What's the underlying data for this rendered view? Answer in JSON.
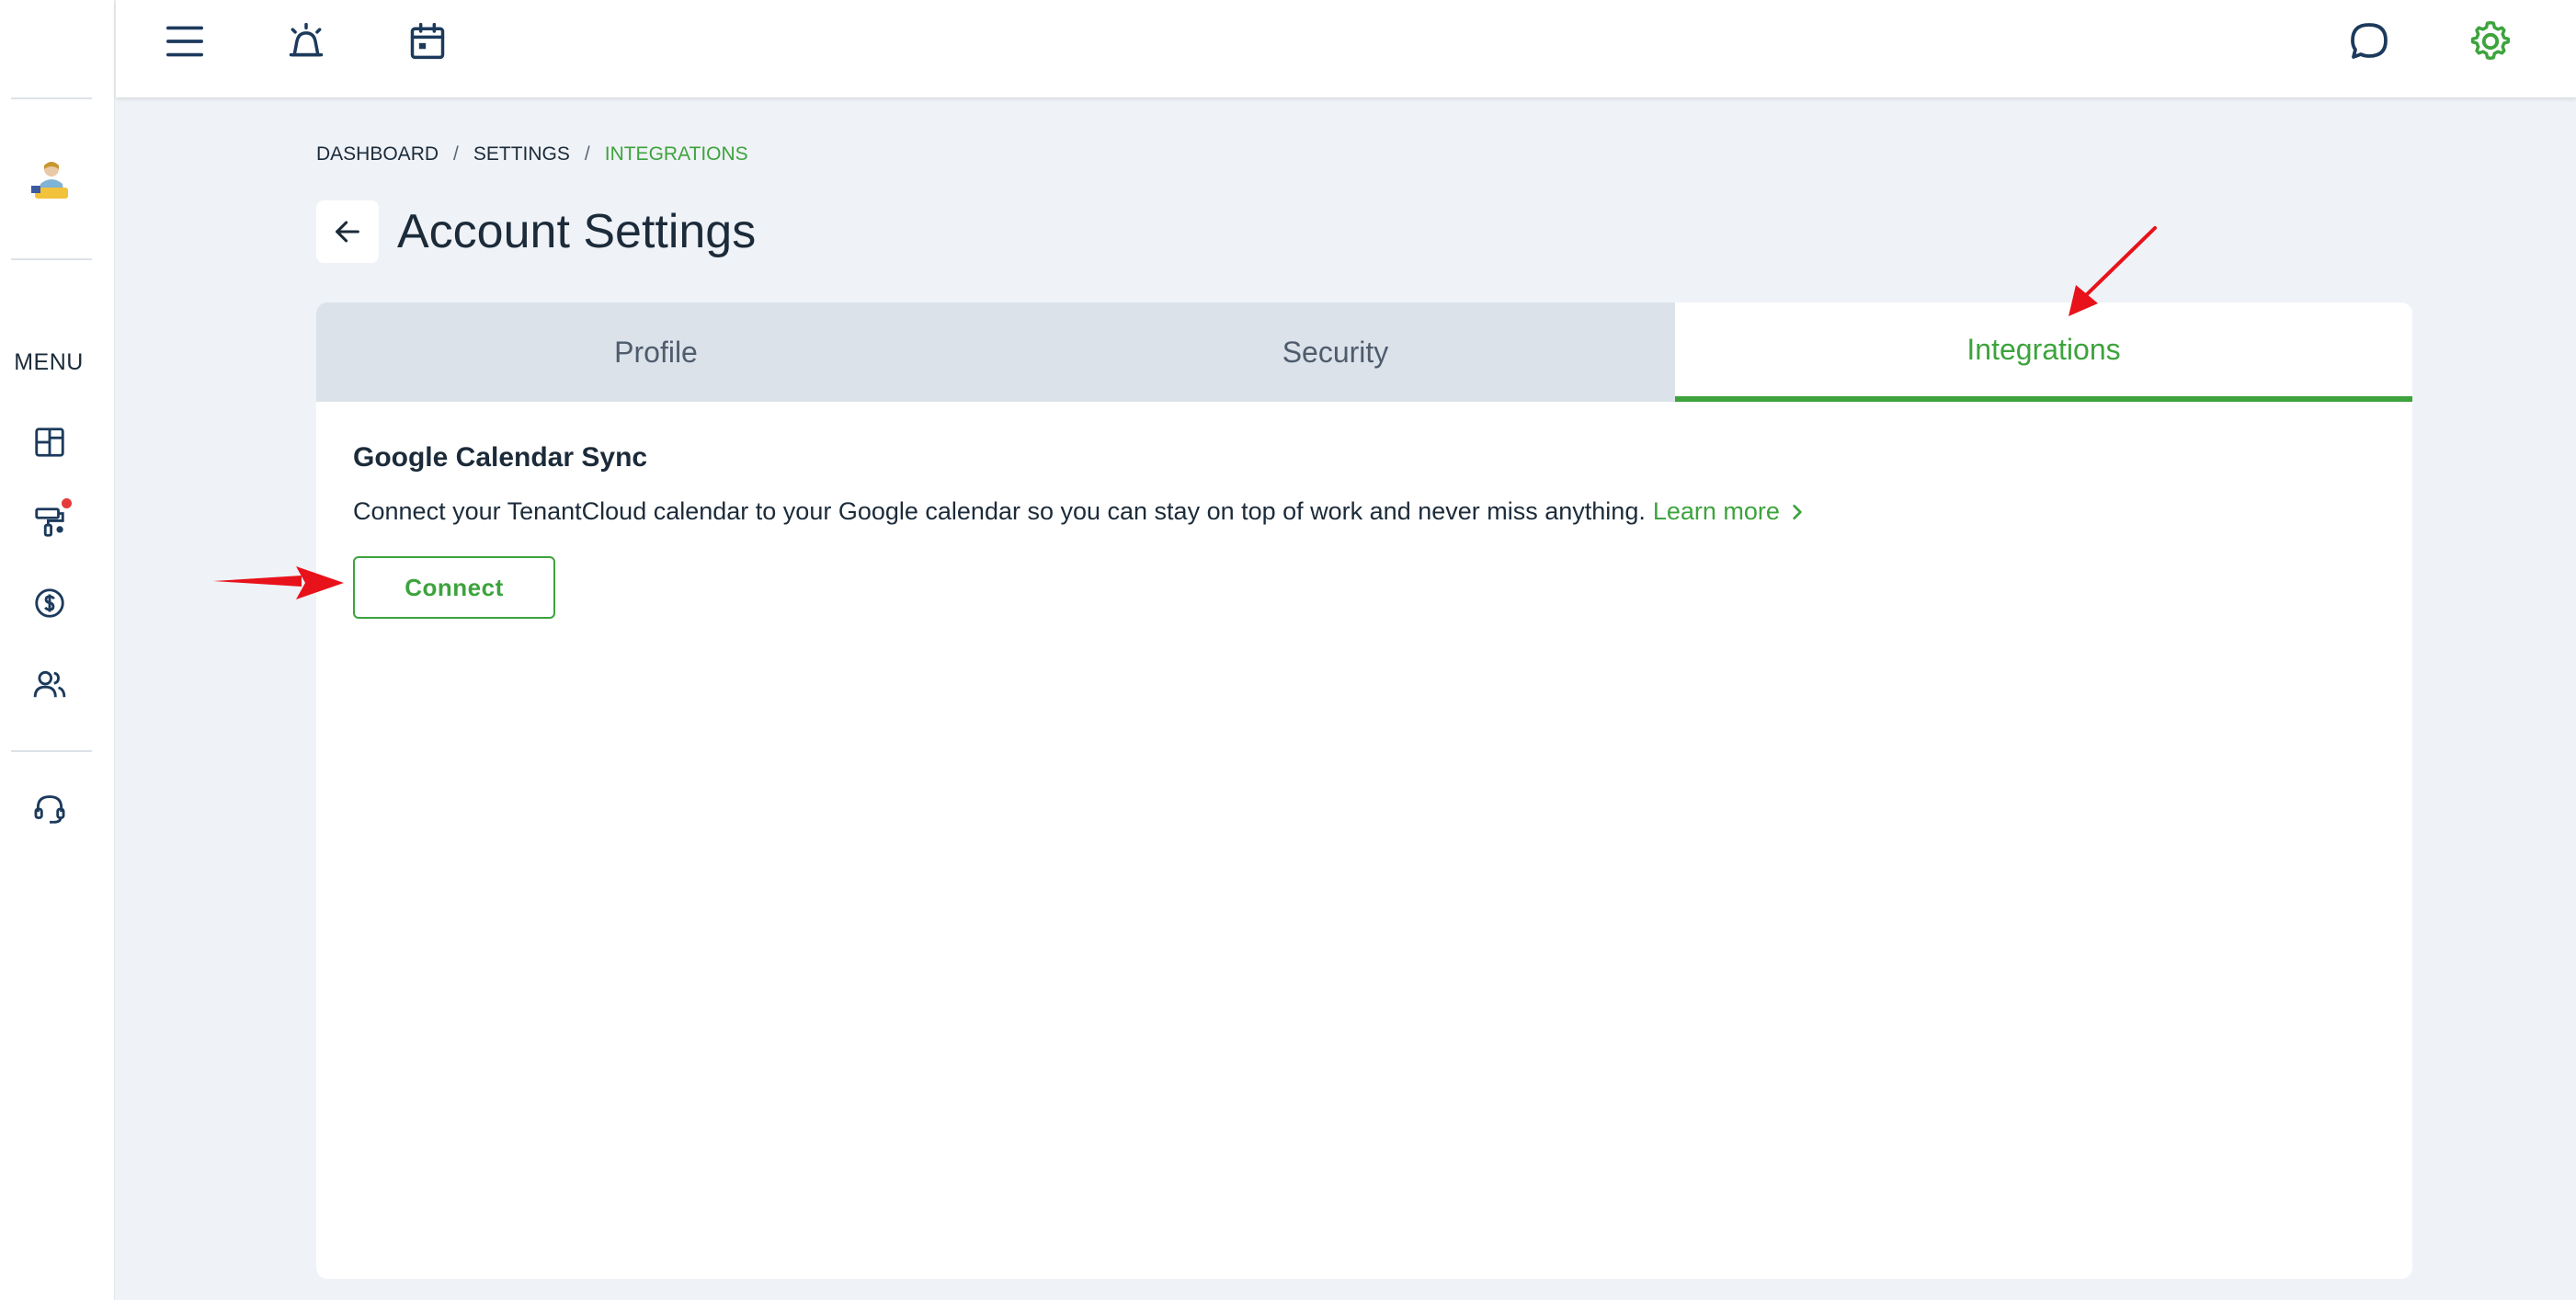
{
  "sidebar": {
    "menu_label": "MENU",
    "items": [
      {
        "icon": "dashboard-icon"
      },
      {
        "icon": "maintenance-icon",
        "has_notification": true
      },
      {
        "icon": "accounting-icon"
      },
      {
        "icon": "contacts-icon"
      },
      {
        "icon": "support-icon"
      }
    ]
  },
  "topbar": {
    "icons": [
      "menu-icon",
      "alarm-icon",
      "calendar-icon",
      "chat-icon",
      "settings-gear-icon"
    ]
  },
  "breadcrumb": {
    "items": [
      "DASHBOARD",
      "SETTINGS",
      "INTEGRATIONS"
    ],
    "separator": "/"
  },
  "page": {
    "title": "Account Settings"
  },
  "tabs": [
    {
      "label": "Profile",
      "active": false
    },
    {
      "label": "Security",
      "active": false
    },
    {
      "label": "Integrations",
      "active": true
    }
  ],
  "integration": {
    "title": "Google Calendar Sync",
    "description": "Connect your TenantCloud calendar to your Google calendar so you can stay on top of work and never miss anything.",
    "learn_more": "Learn more",
    "connect_label": "Connect"
  },
  "colors": {
    "accent": "#3da33d",
    "background": "#eff2f6",
    "tab_inactive": "#dce2ea",
    "text": "#1c2b3a",
    "annotation": "#e8121a"
  }
}
